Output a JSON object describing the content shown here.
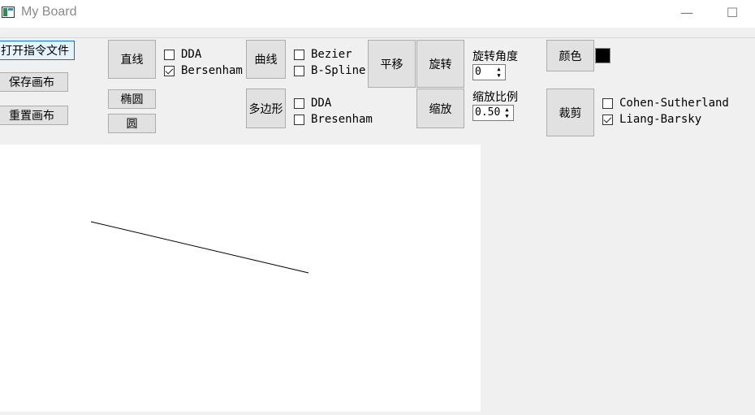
{
  "window": {
    "title": "My Board",
    "minimize_glyph": "—",
    "maximize_glyph": "☐"
  },
  "file_buttons": {
    "open": "打开指令文件",
    "save": "保存画布",
    "reset": "重置画布"
  },
  "shapes": {
    "line": "直线",
    "ellipse": "椭圆",
    "circle": "圆",
    "curve": "曲线",
    "polygon": "多边形"
  },
  "line_algorithms": [
    {
      "label": "DDA",
      "checked": false
    },
    {
      "label": "Bersenham",
      "checked": true
    }
  ],
  "curve_algorithms": [
    {
      "label": "Bezier",
      "checked": false
    },
    {
      "label": "B-Spline",
      "checked": false
    }
  ],
  "polygon_algorithms": [
    {
      "label": "DDA",
      "checked": false
    },
    {
      "label": "Bresenham",
      "checked": false
    }
  ],
  "transform": {
    "translate": "平移",
    "rotate": "旋转",
    "scale": "缩放",
    "rotate_label": "旋转角度",
    "rotate_value": "0",
    "scale_label": "缩放比例",
    "scale_value": "0.50"
  },
  "color": {
    "button": "颜色",
    "current": "#000000"
  },
  "clip": {
    "button": "裁剪",
    "algorithms": [
      {
        "label": "Cohen-Sutherland",
        "checked": false
      },
      {
        "label": "Liang-Barsky",
        "checked": true
      }
    ]
  },
  "colors": {
    "canvas_bg": "#ffffff",
    "panel_bg": "#f0f0f0",
    "stroke": "#000000"
  }
}
